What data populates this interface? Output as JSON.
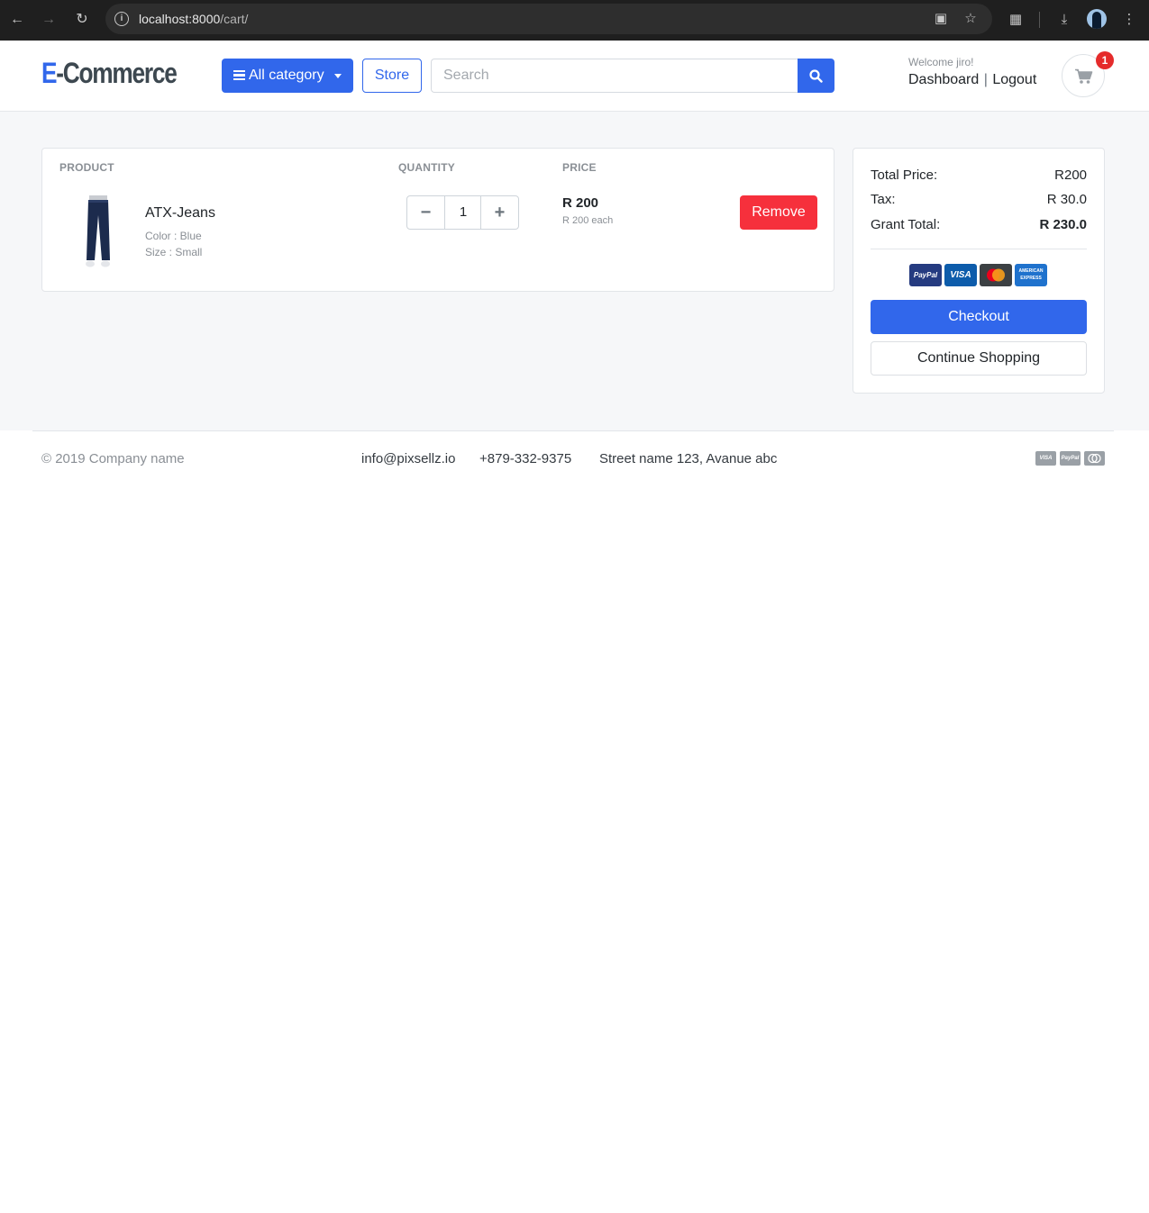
{
  "browser": {
    "url_host": "localhost:8000",
    "url_path": "/cart/"
  },
  "header": {
    "logo_first": "E",
    "logo_rest": "-Commerce",
    "category_label": "All category",
    "store_label": "Store",
    "search_placeholder": "Search",
    "welcome": "Welcome jiro!",
    "dashboard_label": "Dashboard",
    "logout_label": "Logout",
    "cart_count": "1"
  },
  "cart": {
    "columns": {
      "product": "PRODUCT",
      "quantity": "QUANTITY",
      "price": "PRICE"
    },
    "items": [
      {
        "name": "ATX-Jeans",
        "color": "Color : Blue",
        "size": "Size : Small",
        "quantity": "1",
        "price": "R 200",
        "price_each": "R 200 each",
        "remove_label": "Remove"
      }
    ]
  },
  "summary": {
    "total_label": "Total Price:",
    "total_value": "R200",
    "tax_label": "Tax:",
    "tax_value": "R 30.0",
    "grand_label": "Grant Total:",
    "grand_value": "R 230.0",
    "payment_icons": [
      "paypal-icon",
      "visa-icon",
      "mastercard-icon",
      "amex-icon"
    ],
    "paypal_text": "PayPal",
    "visa_text": "VISA",
    "amex_text": "AMERICAN EXPRESS",
    "checkout_label": "Checkout",
    "continue_label": "Continue Shopping"
  },
  "footer": {
    "copyright": "© 2019 Company name",
    "email": "info@pixsellz.io",
    "phone": "+879-332-9375",
    "address": "Street name 123, Avanue abc",
    "card_icons": [
      "visa-icon",
      "paypal-icon",
      "mastercard-icon"
    ],
    "visa_text": "VISA",
    "paypal_text": "PayPal"
  },
  "colors": {
    "primary": "#3167eb",
    "danger": "#f6303c",
    "badge": "#e52b2b",
    "background": "#f6f7f9"
  }
}
